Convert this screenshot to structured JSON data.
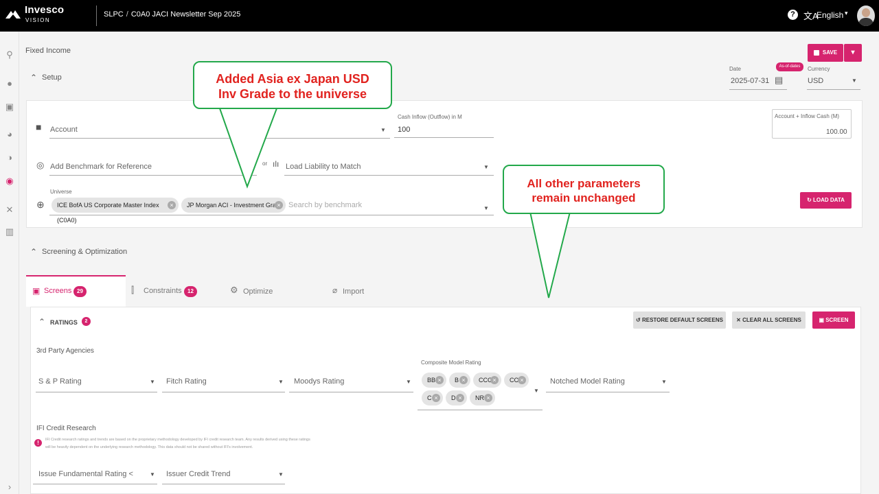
{
  "header": {
    "brand": "Invesco",
    "brand_sub": "VISION",
    "crumb_root": "SLPC",
    "crumb_sep": "/",
    "crumb_current": "C0A0 JACI Newsletter Sep 2025",
    "help": "?",
    "lang_icon": "文A",
    "language": "English"
  },
  "page": {
    "section": "Fixed Income",
    "setup_label": "Setup",
    "save_label": "SAVE",
    "date_label": "Date",
    "date_value": "2025-07-31",
    "asof_label": "As-of-dates",
    "currency_label": "Currency",
    "currency_value": "USD"
  },
  "setup": {
    "account_placeholder": "Account",
    "cash_label": "Cash Inflow (Outflow) in M",
    "cash_value": "100",
    "acct_cash_label": "Account + Inflow Cash (M)",
    "acct_cash_value": "100.00",
    "benchmark_placeholder": "Add Benchmark for Reference",
    "or_text": "or",
    "liability_placeholder": "Load Liability to Match",
    "universe_label": "Universe",
    "universe_chips": [
      "ICE BofA US Corporate Master Index (C0A0)",
      "JP Morgan ACI - Investment Grade"
    ],
    "universe_search": "Search by benchmark",
    "load_data": "LOAD DATA"
  },
  "screening": {
    "section_label": "Screening & Optimization",
    "tabs": [
      {
        "label": "Screens",
        "badge": "29"
      },
      {
        "label": "Constraints",
        "badge": "12"
      },
      {
        "label": "Optimize"
      },
      {
        "label": "Import"
      }
    ],
    "ratings_label": "RATINGS",
    "ratings_badge": "2",
    "restore_label": "RESTORE DEFAULT SCREENS",
    "clear_label": "CLEAR ALL SCREENS",
    "screen_label": "SCREEN",
    "agencies_label": "3rd Party Agencies",
    "sp_rating": "S & P Rating",
    "fitch_rating": "Fitch Rating",
    "moodys_rating": "Moodys Rating",
    "composite_label": "Composite Model Rating",
    "composite_chips": [
      "BB",
      "B",
      "CCC",
      "CC",
      "C",
      "D",
      "NR"
    ],
    "notched_rating": "Notched Model Rating",
    "ifi_label": "IFI Credit Research",
    "ifi_note_1": "IFI Credit research ratings and trends are based on the proprietary methodology developed by IFI credit research team. Any results derived using these ratings",
    "ifi_note_2": "will be heavily dependent on the underlying research methodology. This data should not be shared without IFI's involvement.",
    "issue_rating": "Issue Fundamental Rating <",
    "issuer_trend": "Issuer Credit Trend"
  },
  "callouts": {
    "left_line1": "Added Asia ex Japan USD",
    "left_line2": "Inv Grade to the universe",
    "right_line1": "All other parameters",
    "right_line2": "remain unchanged"
  },
  "colors": {
    "accent": "#d6246e",
    "callout_border": "#22a84a",
    "callout_text": "#e1231f"
  }
}
